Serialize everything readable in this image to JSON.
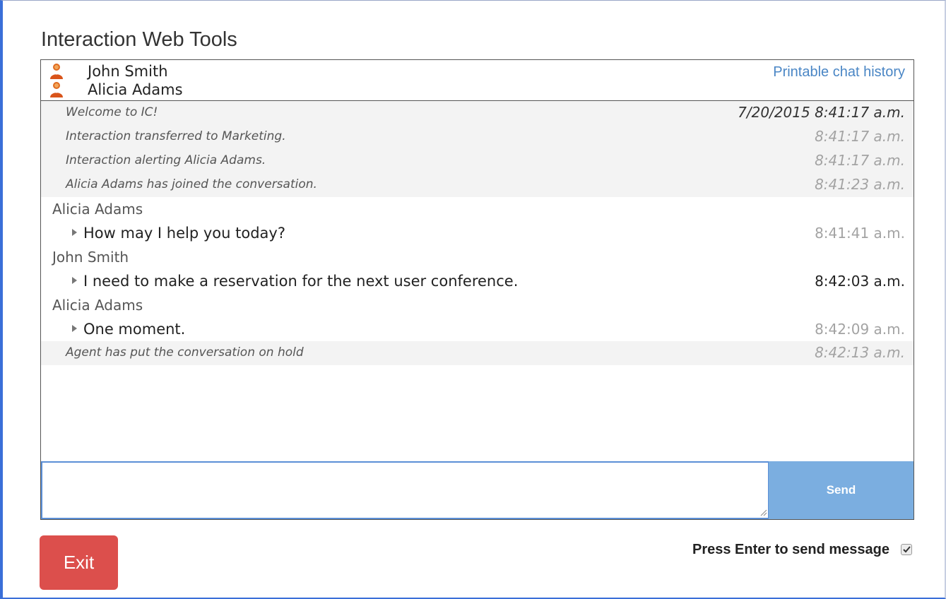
{
  "app": {
    "title": "Interaction Web Tools"
  },
  "participants": [
    {
      "name": "John Smith",
      "icon": "person-icon"
    },
    {
      "name": "Alicia Adams",
      "icon": "person-icon"
    }
  ],
  "header": {
    "printable_link": "Printable chat history"
  },
  "transcript": [
    {
      "type": "system",
      "text": "Welcome to IC!",
      "time": "7/20/2015 8:41:17 a.m."
    },
    {
      "type": "system",
      "text": "Interaction transferred to Marketing.",
      "time": "8:41:17 a.m."
    },
    {
      "type": "system",
      "text": "Interaction alerting Alicia Adams.",
      "time": "8:41:17 a.m."
    },
    {
      "type": "system",
      "text": "Alicia Adams has joined the conversation.",
      "time": "8:41:23 a.m."
    },
    {
      "type": "sender",
      "name": "Alicia Adams"
    },
    {
      "type": "message",
      "text": "How may I help you today?",
      "time": "8:41:41 a.m."
    },
    {
      "type": "sender",
      "name": "John Smith"
    },
    {
      "type": "message",
      "text": "I need to make a reservation for the next user conference.",
      "time": "8:42:03 a.m."
    },
    {
      "type": "sender",
      "name": "Alicia Adams"
    },
    {
      "type": "message",
      "text": "One moment.",
      "time": "8:42:09 a.m."
    },
    {
      "type": "system",
      "text": "Agent has put the conversation on hold",
      "time": "8:42:13 a.m."
    }
  ],
  "composer": {
    "value": "",
    "send_label": "Send"
  },
  "footer": {
    "exit_label": "Exit",
    "enter_label": "Press Enter to send message",
    "enter_checked": true
  },
  "colors": {
    "accent": "#3a6fd8",
    "send_button": "#7baee0",
    "exit_button": "#dc4f4c",
    "link": "#4a86c5"
  }
}
